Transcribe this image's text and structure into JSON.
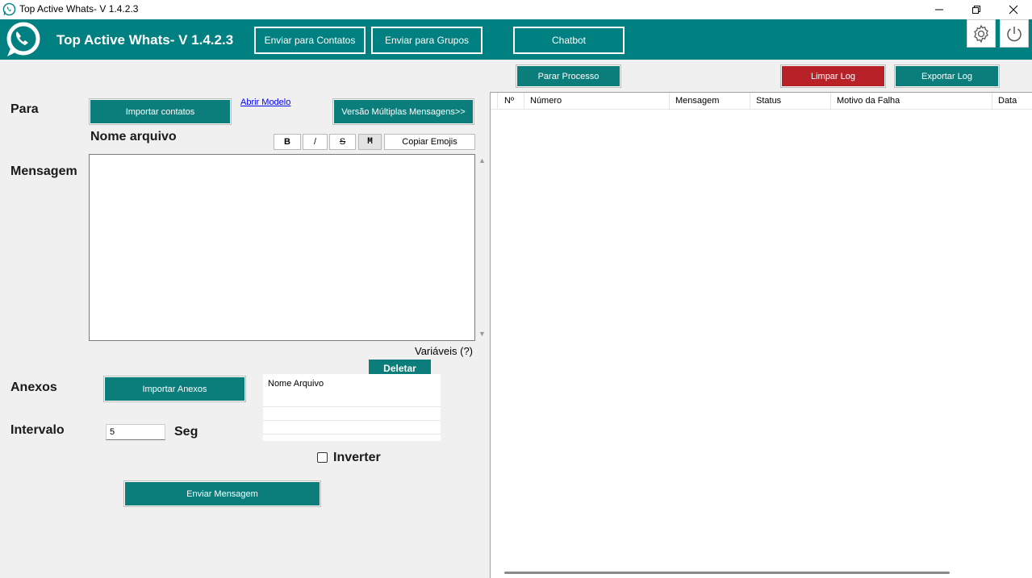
{
  "window": {
    "title": "Top Active Whats- V 1.4.2.3",
    "controls": [
      "minimize-icon",
      "restore-icon",
      "close-icon"
    ]
  },
  "header": {
    "app_name": "Top Active Whats- V 1.4.2.3",
    "nav": {
      "contacts": "Enviar para Contatos",
      "groups": "Enviar para Grupos",
      "chatbot": "Chatbot"
    },
    "icons": [
      "whatsapp-logo-icon",
      "gear-icon",
      "power-icon"
    ]
  },
  "toolbar": {
    "stop": "Parar Processo",
    "clear_log": "Limpar Log",
    "export_log": "Exportar Log"
  },
  "form": {
    "para_label": "Para",
    "import_contacts": "Importar contatos",
    "open_model": "Abrir Modelo",
    "multi_version": "Versão Múltiplas Mensagens>>",
    "file_name_label": "Nome arquivo",
    "format": {
      "bold": "B",
      "italic": "/",
      "strike": "S",
      "mono": "M",
      "copy_emojis": "Copiar Emojis"
    },
    "message_label": "Mensagem",
    "message_value": "",
    "variables": "Variáveis (?)",
    "delete": "Deletar",
    "attachments_label": "Anexos",
    "import_attachments": "Importar Anexos",
    "file_list_header": "Nome Arquivo",
    "interval_label": "Intervalo",
    "interval_value": "5",
    "interval_unit": "Seg",
    "invert_label": "Inverter",
    "invert_checked": false,
    "send": "Enviar Mensagem"
  },
  "log": {
    "columns": [
      "Nº",
      "Número",
      "Mensagem",
      "Status",
      "Motivo da Falha",
      "Data"
    ],
    "rows": []
  },
  "colors": {
    "brand": "#008080",
    "button": "#0b7d7a",
    "danger": "#b72127"
  }
}
